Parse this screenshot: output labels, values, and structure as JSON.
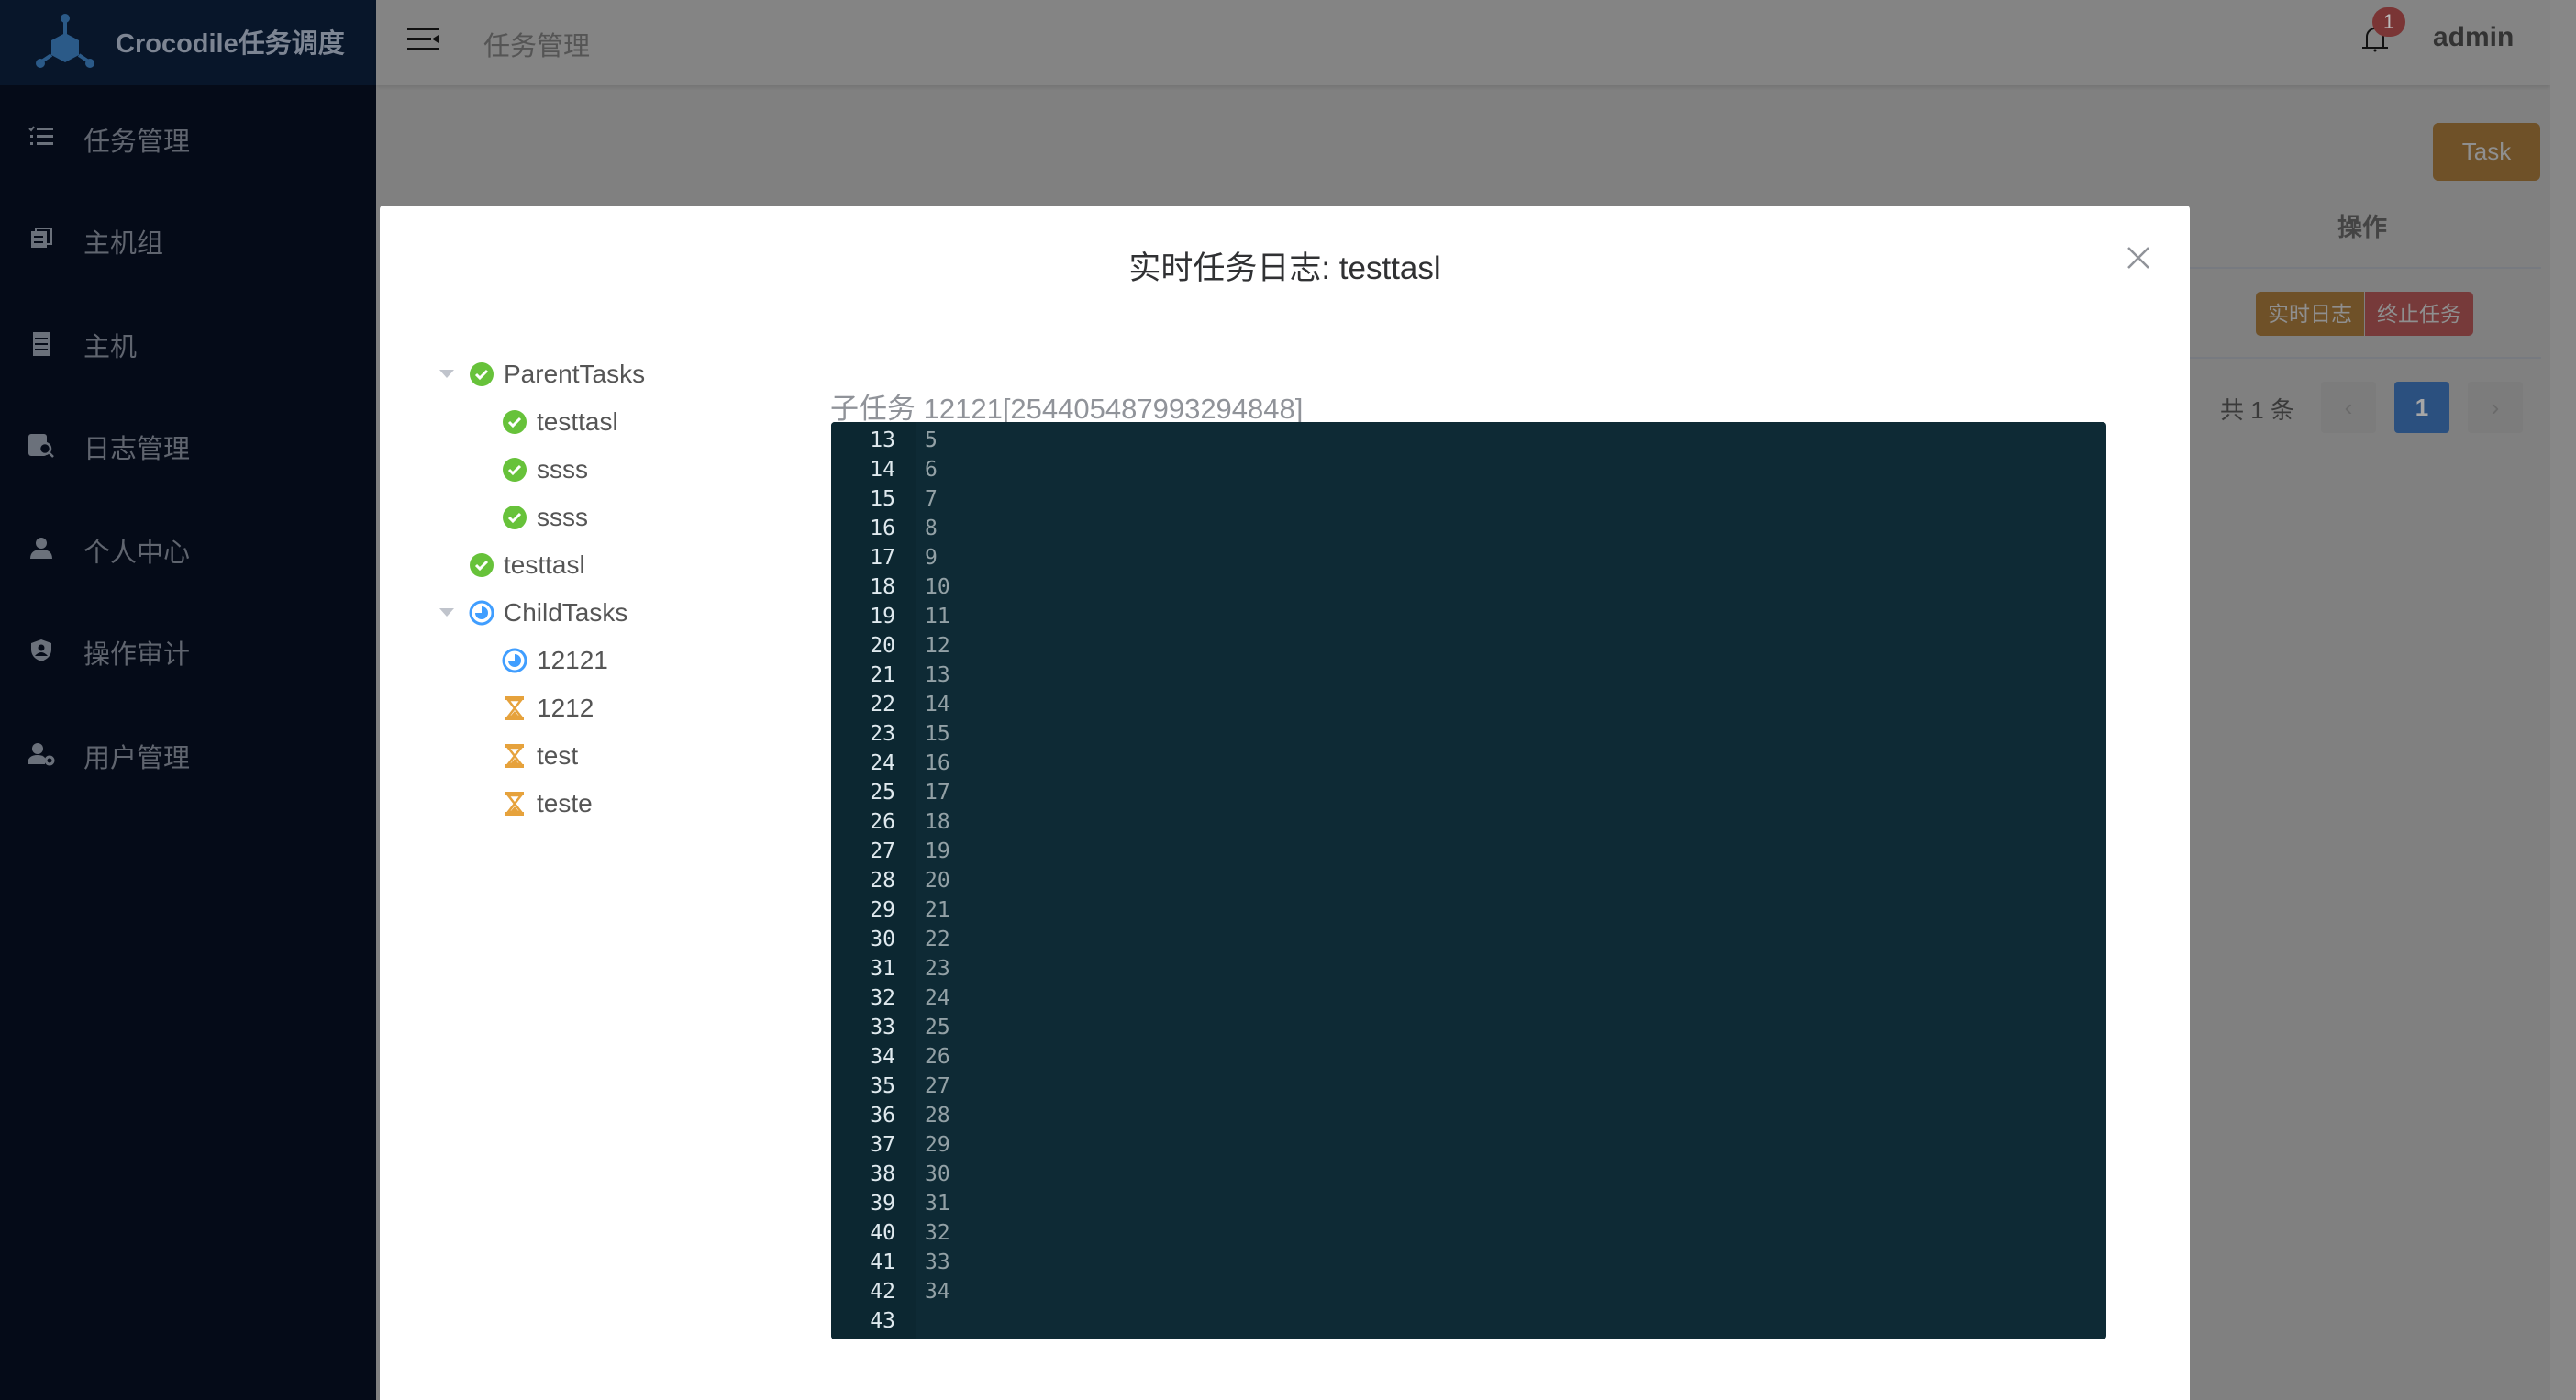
{
  "app": {
    "title": "Crocodile任务调度"
  },
  "sidebar": {
    "items": [
      {
        "label": "任务管理",
        "icon": "task-list-icon"
      },
      {
        "label": "主机组",
        "icon": "host-group-icon"
      },
      {
        "label": "主机",
        "icon": "server-icon"
      },
      {
        "label": "日志管理",
        "icon": "log-search-icon"
      },
      {
        "label": "个人中心",
        "icon": "user-icon"
      },
      {
        "label": "操作审计",
        "icon": "shield-user-icon"
      },
      {
        "label": "用户管理",
        "icon": "user-gear-icon"
      }
    ]
  },
  "header": {
    "breadcrumb": "任务管理",
    "notification_count": "1",
    "user": "admin"
  },
  "background": {
    "task_button": "Task",
    "column_header": "操作",
    "row_actions": {
      "realtime_log": "实时日志",
      "stop_task": "终止任务"
    },
    "pagination": {
      "total": "共 1 条",
      "current": "1"
    }
  },
  "colors": {
    "success": "#67c23a",
    "running": "#409eff",
    "pending": "#e6a23c",
    "log_bg": "#0e2a35"
  },
  "modal": {
    "title": "实时任务日志: testtasl",
    "tree": [
      {
        "label": "ParentTasks",
        "status": "success",
        "level": 0,
        "expandable": true
      },
      {
        "label": "testtasl",
        "status": "success",
        "level": 1
      },
      {
        "label": "ssss",
        "status": "success",
        "level": 1
      },
      {
        "label": "ssss",
        "status": "success",
        "level": 1
      },
      {
        "label": "testtasl",
        "status": "success",
        "level": 0
      },
      {
        "label": "ChildTasks",
        "status": "running",
        "level": 0,
        "expandable": true
      },
      {
        "label": "12121",
        "status": "running",
        "level": 1
      },
      {
        "label": "1212",
        "status": "pending",
        "level": 1
      },
      {
        "label": "test",
        "status": "pending",
        "level": 1
      },
      {
        "label": "teste",
        "status": "pending",
        "level": 1
      }
    ],
    "log_label": "子任务 12121[254405487993294848]",
    "log_lines": [
      {
        "n": "13",
        "t": "5"
      },
      {
        "n": "14",
        "t": "6"
      },
      {
        "n": "15",
        "t": "7"
      },
      {
        "n": "16",
        "t": "8"
      },
      {
        "n": "17",
        "t": "9"
      },
      {
        "n": "18",
        "t": "10"
      },
      {
        "n": "19",
        "t": "11"
      },
      {
        "n": "20",
        "t": "12"
      },
      {
        "n": "21",
        "t": "13"
      },
      {
        "n": "22",
        "t": "14"
      },
      {
        "n": "23",
        "t": "15"
      },
      {
        "n": "24",
        "t": "16"
      },
      {
        "n": "25",
        "t": "17"
      },
      {
        "n": "26",
        "t": "18"
      },
      {
        "n": "27",
        "t": "19"
      },
      {
        "n": "28",
        "t": "20"
      },
      {
        "n": "29",
        "t": "21"
      },
      {
        "n": "30",
        "t": "22"
      },
      {
        "n": "31",
        "t": "23"
      },
      {
        "n": "32",
        "t": "24"
      },
      {
        "n": "33",
        "t": "25"
      },
      {
        "n": "34",
        "t": "26"
      },
      {
        "n": "35",
        "t": "27"
      },
      {
        "n": "36",
        "t": "28"
      },
      {
        "n": "37",
        "t": "29"
      },
      {
        "n": "38",
        "t": "30"
      },
      {
        "n": "39",
        "t": "31"
      },
      {
        "n": "40",
        "t": "32"
      },
      {
        "n": "41",
        "t": "33"
      },
      {
        "n": "42",
        "t": "34"
      },
      {
        "n": "43",
        "t": ""
      }
    ]
  }
}
